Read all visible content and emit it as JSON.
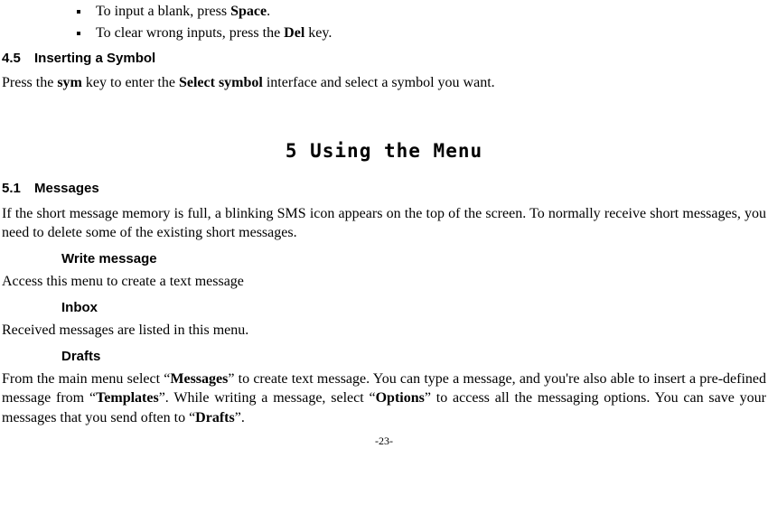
{
  "bullets": [
    {
      "pre": "To input a blank, press ",
      "bold": "Space",
      "post": "."
    },
    {
      "pre": "To clear wrong inputs, press the ",
      "bold": "Del",
      "post": " key."
    }
  ],
  "sec45": {
    "num": "4.5",
    "title": "Inserting a Symbol"
  },
  "p45": {
    "t1": "Press the ",
    "b1": "sym",
    "t2": " key to enter the ",
    "b2": "Select symbol",
    "t3": " interface and select a symbol you want."
  },
  "chapter": "5  Using the Menu",
  "sec51": {
    "num": "5.1",
    "title": "Messages"
  },
  "p51": "If the short message memory is full, a blinking SMS icon appears on the top of the screen. To normally receive short messages, you need to delete some of the existing short messages.",
  "sh_write": "Write message",
  "p_write": "Access this menu to create a text message",
  "sh_inbox": "Inbox",
  "p_inbox": "Received messages are listed in this menu.",
  "sh_drafts": "Drafts",
  "p_drafts": {
    "t1": "From the main menu select “",
    "b1": "Messages",
    "t2": "” to create text message. You can type a message, and you're also able to insert a pre-defined message from “",
    "b2": "Templates",
    "t3": "”. While writing a message, select “",
    "b3": "Options",
    "t4": "” to access all the messaging options. You can save your messages that you send often to “",
    "b4": "Drafts",
    "t5": "”."
  },
  "footer": "-23-"
}
